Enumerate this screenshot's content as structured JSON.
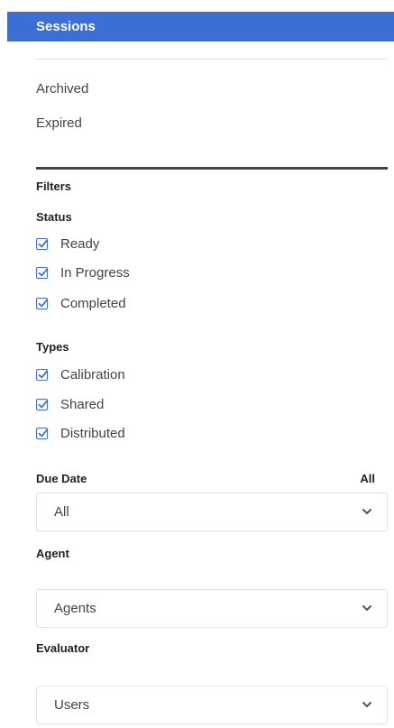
{
  "header": {
    "title": "Sessions"
  },
  "nav": {
    "archived": "Archived",
    "expired": "Expired"
  },
  "filters": {
    "title": "Filters",
    "status": {
      "heading": "Status",
      "options": [
        {
          "label": "Ready",
          "checked": true
        },
        {
          "label": "In Progress",
          "checked": true
        },
        {
          "label": "Completed",
          "checked": true
        }
      ]
    },
    "types": {
      "heading": "Types",
      "options": [
        {
          "label": "Calibration",
          "checked": true
        },
        {
          "label": "Shared",
          "checked": true
        },
        {
          "label": "Distributed",
          "checked": true
        }
      ]
    },
    "due_date": {
      "label": "Due Date",
      "summary": "All",
      "selected": "All"
    },
    "agent": {
      "label": "Agent",
      "selected": "Agents"
    },
    "evaluator": {
      "label": "Evaluator",
      "selected": "Users"
    }
  },
  "colors": {
    "accent": "#3b6fd6",
    "checkbox": "#3b6fd6",
    "text": "#444444"
  },
  "icons": {
    "checkbox": "checkbox-checked-icon",
    "dropdown": "chevron-down-icon"
  }
}
